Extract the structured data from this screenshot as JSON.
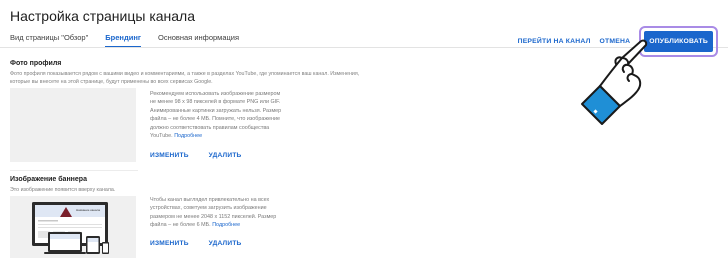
{
  "header": {
    "title": "Настройка страницы канала"
  },
  "tabs": [
    {
      "label": "Вид страницы \"Обзор\"",
      "active": false
    },
    {
      "label": "Брендинг",
      "active": true
    },
    {
      "label": "Основная информация",
      "active": false
    }
  ],
  "actions": {
    "view_channel": "ПЕРЕЙТИ НА КАНАЛ",
    "cancel": "ОТМЕНА",
    "publish": "ОПУБЛИКОВАТЬ"
  },
  "profile_photo": {
    "title": "Фото профиля",
    "desc_line1": "Фото профиля показывается рядом с вашими видео и комментариями, а также в разделах YouTube, где упоминается ваш канал. Изменения,",
    "desc_line2": "которые вы внесете на этой странице, будут применены во всех сервисах Google.",
    "info_lines": [
      "Рекомендуем использовать изображение размером",
      "не менее 98 x 98 пикселей в формате PNG или GIF.",
      "Анимированные картинки загружать нельзя. Размер",
      "файла – не более 4 МБ. Помните, что изображение",
      "должно соответствовать правилам сообщества",
      "YouTube."
    ],
    "more_link": "Подробнее",
    "change": "ИЗМЕНИТЬ",
    "delete": "УДАЛИТЬ"
  },
  "banner": {
    "title": "Изображение баннера",
    "desc": "Это изображение появится вверху канала.",
    "info_lines": [
      "Чтобы канал выглядел привлекательно на всех",
      "устройствах, советуем загрузить изображение",
      "размером не менее 2048 x 1152 пикселей. Размер",
      "файла – не более 6 МБ."
    ],
    "more_link": "Подробнее",
    "change": "ИЗМЕНИТЬ",
    "delete": "УДАЛИТЬ",
    "preview_text": "Название канала"
  },
  "colors": {
    "accent": "#1a66cc",
    "highlight_outline": "#a98be6",
    "hand_fill": "#1f8fd6"
  }
}
